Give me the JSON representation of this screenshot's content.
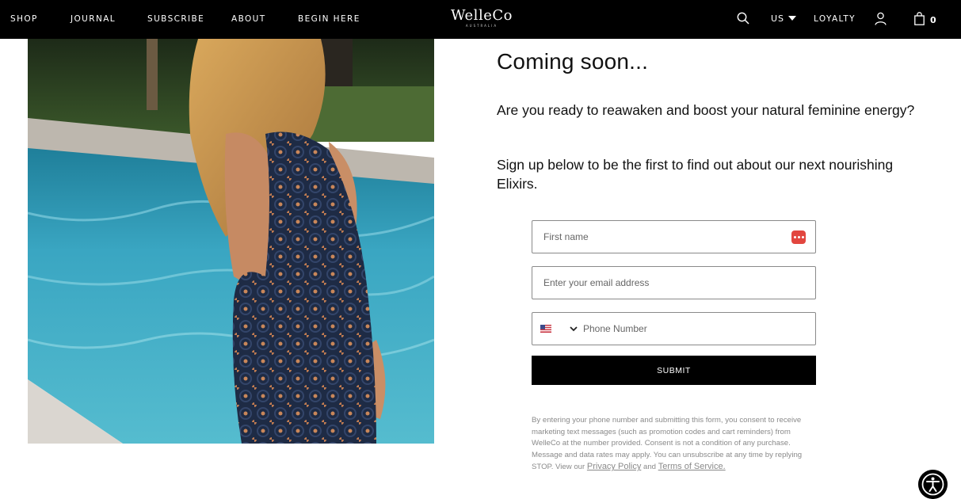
{
  "nav": {
    "links": [
      "SHOP",
      "JOURNAL",
      "SUBSCRIBE",
      "ABOUT",
      "BEGIN HERE"
    ],
    "logo": "WelleCo",
    "logo_sub": "AUSTRALIA",
    "region": "US",
    "loyalty": "LOYALTY",
    "cart_count": "0",
    "icons": [
      "search-icon",
      "chevron-down-icon",
      "user-icon",
      "shopping-bag-icon"
    ]
  },
  "main": {
    "heading": "Coming soon...",
    "paragraph_1": "Are you ready to reawaken and boost your natural feminine energy?",
    "paragraph_2": "Sign up below to be the first to find out about our next nourishing Elixirs."
  },
  "form": {
    "first_name_placeholder": "First name",
    "email_placeholder": "Enter your email address",
    "phone_placeholder": "Phone Number",
    "phone_country": "US",
    "submit_label": "SUBMIT",
    "consent_text": "By entering your phone number and submitting this form, you consent to receive marketing text messages (such as promotion codes and cart reminders) from WelleCo at the number provided. Consent is not a condition of any purchase. Message and data rates may apply. You can unsubscribe at any time by replying STOP. View our",
    "privacy_link": "Privacy Policy",
    "and_text": "and",
    "terms_link": "Terms of Service."
  },
  "colors": {
    "nav_bg": "#000000",
    "button_bg": "#000000",
    "autofill_badge": "#e2463f",
    "pool_water": "#3fa9c4"
  }
}
